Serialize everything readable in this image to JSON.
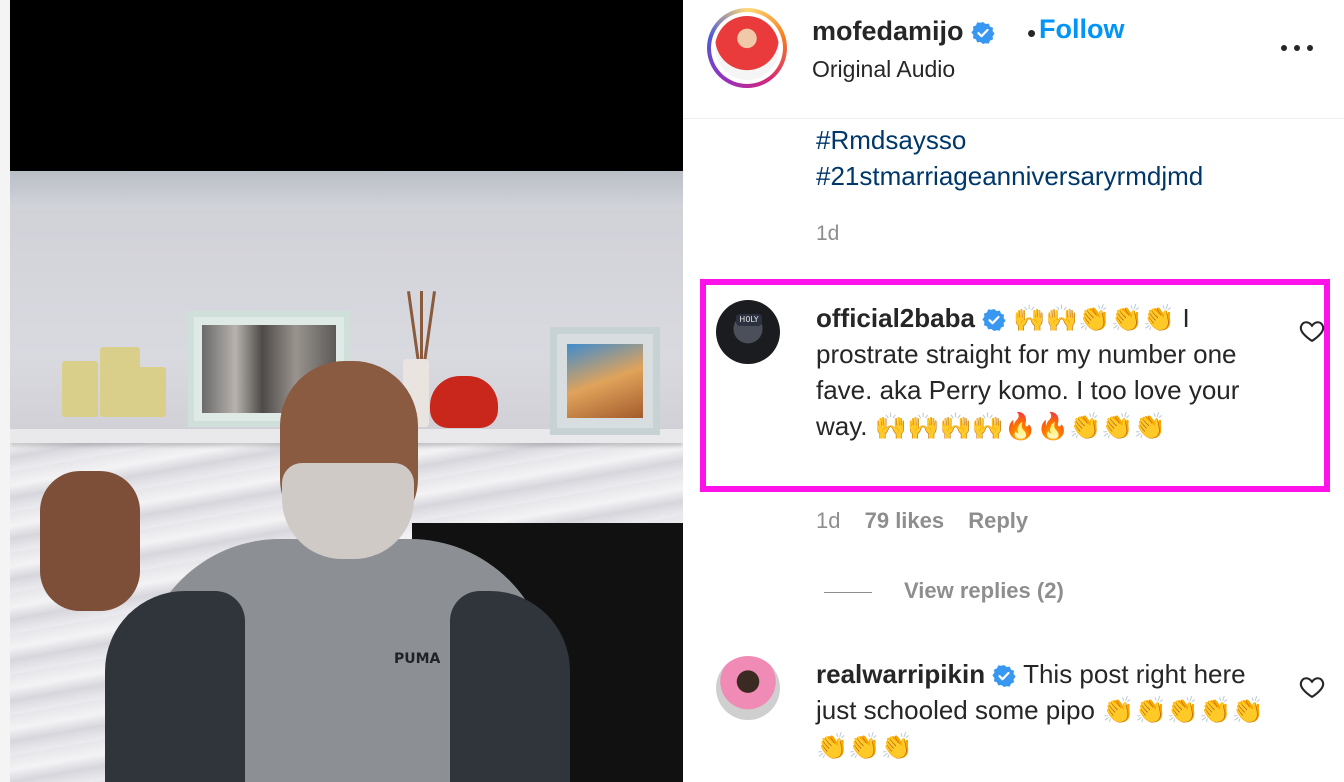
{
  "post": {
    "username": "mofedamijo",
    "separator": "•",
    "follow_label": "Follow",
    "audio_label": "Original Audio",
    "hashtags": [
      "#Rmdsaysso",
      "#21stmarriageanniversaryrmdjmd"
    ],
    "age": "1d"
  },
  "media": {
    "shirt_logo": "PUMA",
    "cap_text": "H0LY"
  },
  "comments": [
    {
      "username": "official2baba",
      "text": "🙌🙌👏👏👏 I prostrate straight for my number one fave. aka Perry komo. I too love your way. 🙌🙌🙌🙌🔥🔥👏👏👏",
      "age": "1d",
      "likes": "79 likes",
      "reply_label": "Reply",
      "view_replies": "View replies (2)"
    },
    {
      "username": "realwarripikin",
      "text": "This post right here just schooled some pipo 👏👏👏👏👏👏👏👏"
    }
  ],
  "colors": {
    "follow": "#0095f6",
    "hashtag": "#00376b",
    "verified": "#3897f0",
    "highlight": "#ff12e9",
    "muted": "#8e8e8e"
  },
  "icons": {
    "verified": "verified-badge-icon",
    "heart": "heart-outline-icon",
    "more": "more-horizontal-icon"
  }
}
